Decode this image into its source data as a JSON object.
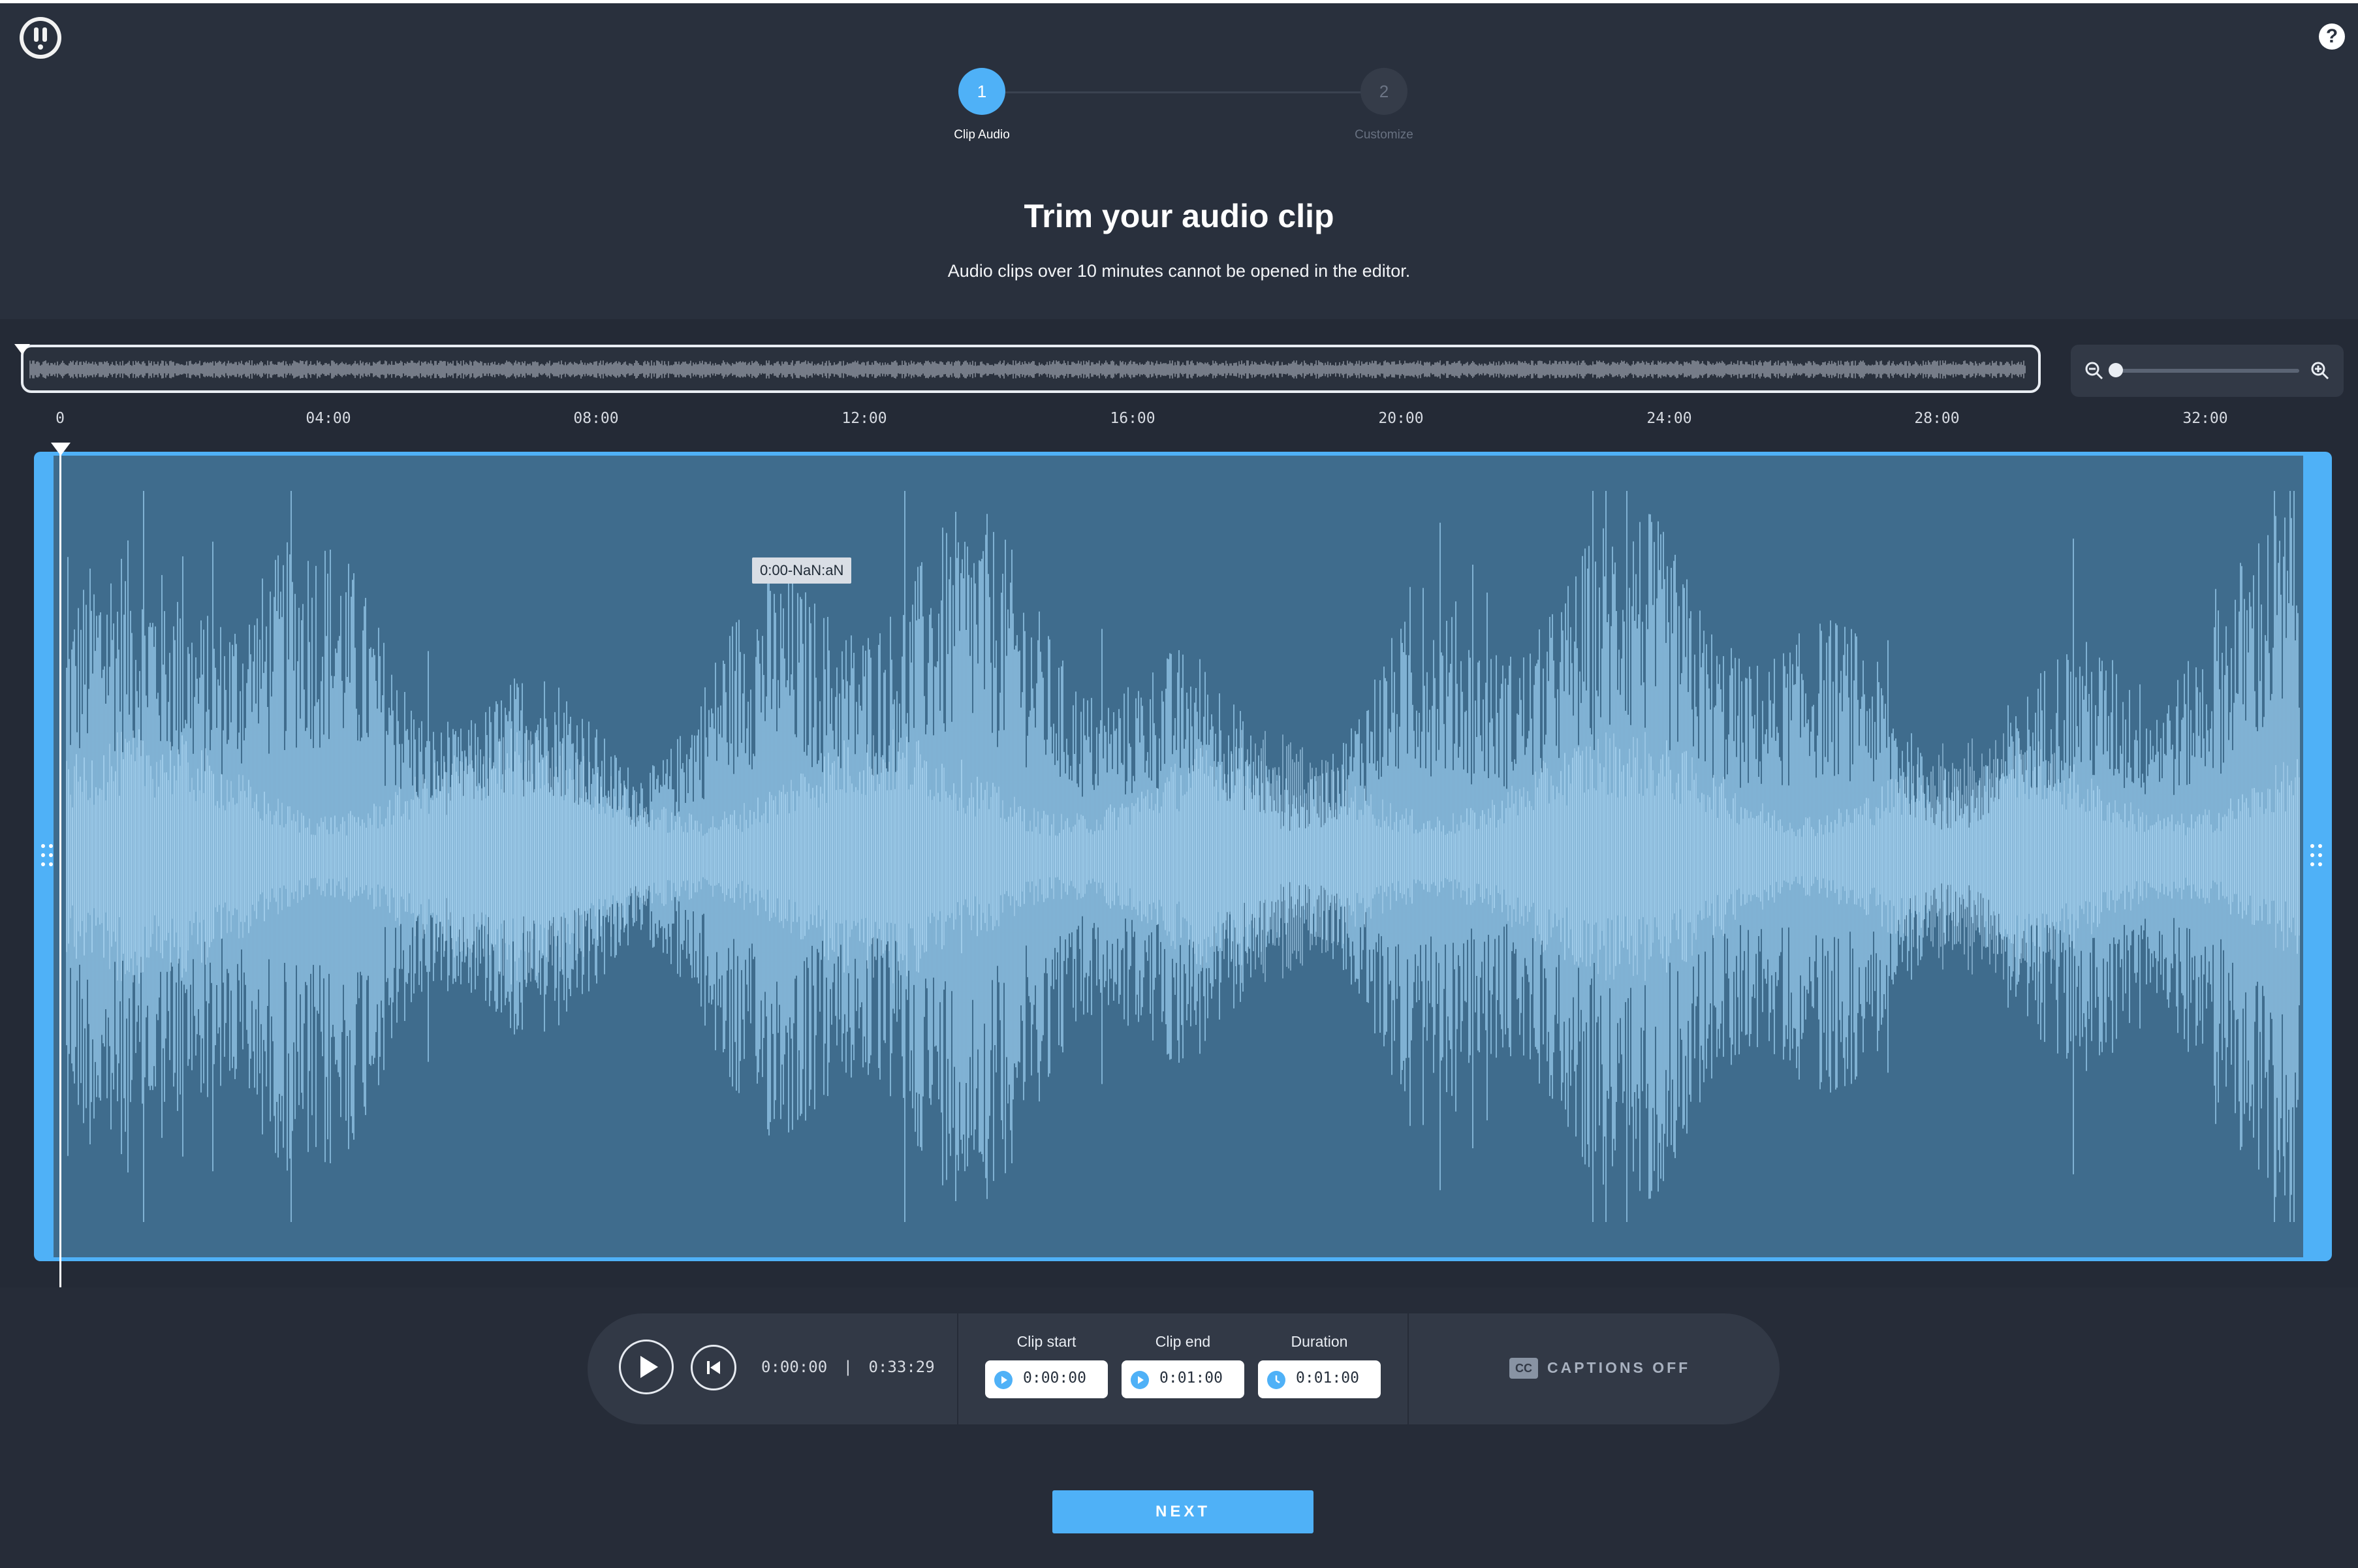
{
  "header": {
    "logo_icon": "brand-logo-icon",
    "help_icon": "help-icon",
    "help_glyph": "?"
  },
  "stepper": {
    "steps": [
      {
        "number": "1",
        "label": "Clip Audio",
        "state": "active"
      },
      {
        "number": "2",
        "label": "Customize",
        "state": "inactive"
      }
    ]
  },
  "page": {
    "title": "Trim your audio clip",
    "subtitle": "Audio clips over 10 minutes cannot be opened in the editor."
  },
  "timeline": {
    "ticks": [
      "0",
      "04:00",
      "08:00",
      "12:00",
      "16:00",
      "20:00",
      "24:00",
      "28:00",
      "32:00"
    ],
    "tooltip": "0:00-NaN:aN",
    "zoom_level": 0,
    "zoom_out_icon": "zoom-out-icon",
    "zoom_in_icon": "zoom-in-icon"
  },
  "player": {
    "current_time": "0:00:00",
    "separator": "|",
    "total_time": "0:33:29",
    "play_icon": "play-icon",
    "rewind_icon": "skip-back-icon"
  },
  "clip": {
    "start_label": "Clip start",
    "start_value": "0:00:00",
    "end_label": "Clip end",
    "end_value": "0:01:00",
    "duration_label": "Duration",
    "duration_value": "0:01:00"
  },
  "captions": {
    "icon_text": "CC",
    "label": "CAPTIONS OFF"
  },
  "actions": {
    "next_label": "NEXT"
  },
  "colors": {
    "accent": "#4fb1f7",
    "background": "#242a36",
    "waveform": "#9fd2f5",
    "selection": "#3f6c8d"
  }
}
